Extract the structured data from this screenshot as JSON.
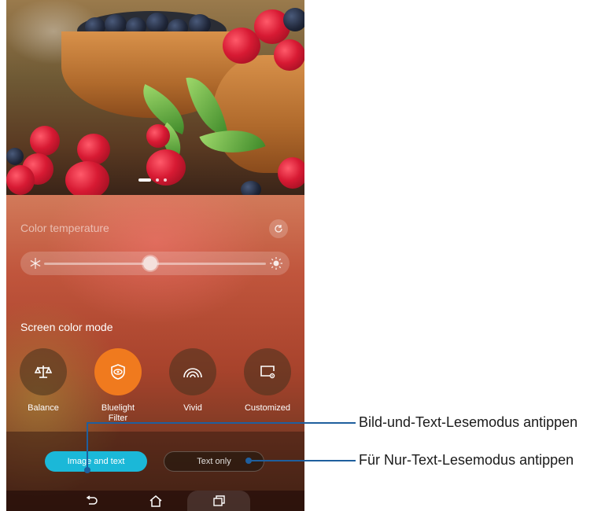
{
  "color_temperature": {
    "label": "Color temperature",
    "slider_value_fraction": 0.48
  },
  "screen_color_mode": {
    "label": "Screen color mode",
    "modes": [
      {
        "label": "Balance",
        "icon": "balance-scale-icon",
        "selected": false
      },
      {
        "label": "Bluelight\nFilter",
        "icon": "eye-shield-icon",
        "selected": true
      },
      {
        "label": "Vivid",
        "icon": "rainbow-icon",
        "selected": false
      },
      {
        "label": "Customized",
        "icon": "custom-screen-icon",
        "selected": false
      }
    ]
  },
  "reading_mode": {
    "image_and_text": "Image and text",
    "text_only": "Text only"
  },
  "navigation": {
    "back": "back-icon",
    "home": "home-icon",
    "recent": "recent-apps-icon"
  },
  "callouts": {
    "image_text": "Bild-und-Text-Lesemodus antippen",
    "text_only": "Für Nur-Text-Lesemodus antippen"
  },
  "colors": {
    "accent_orange": "#f07a1e",
    "accent_cyan": "#1bb8d8",
    "callout_blue": "#1f5f9e"
  }
}
